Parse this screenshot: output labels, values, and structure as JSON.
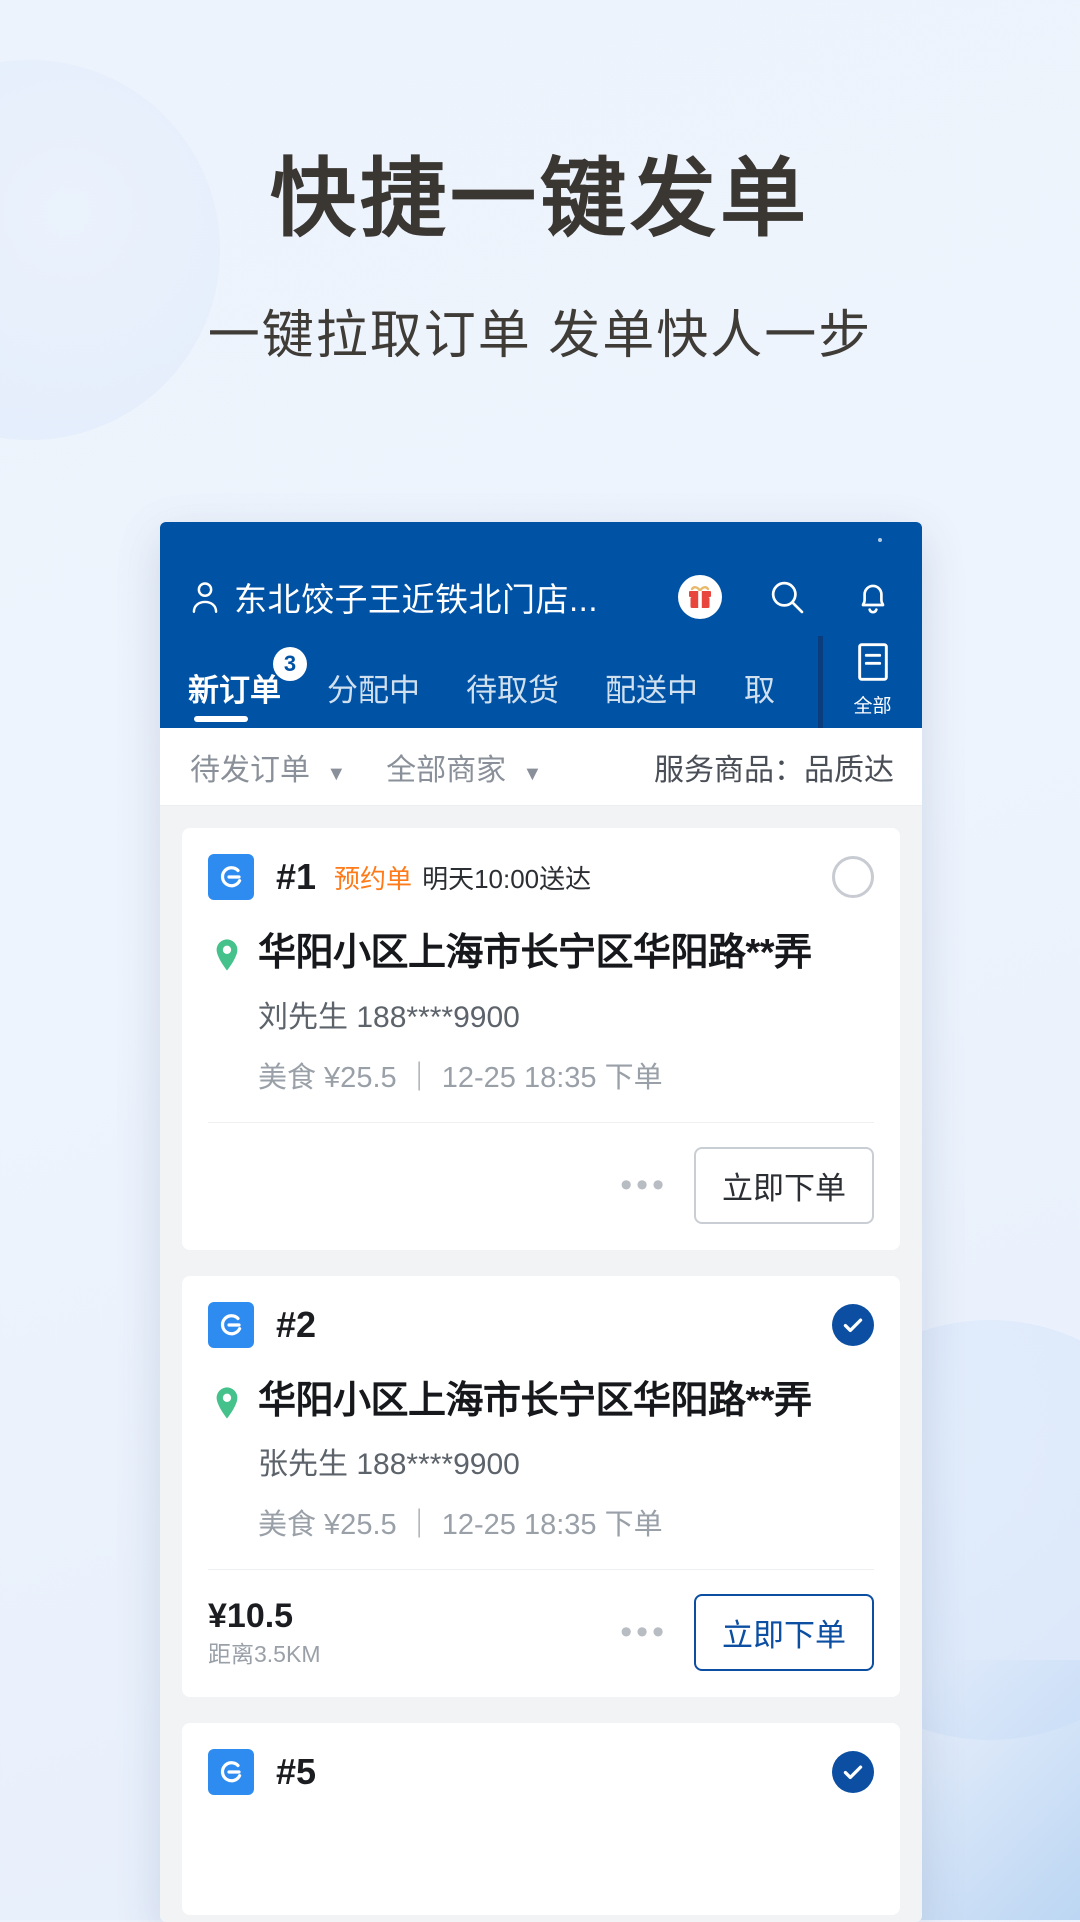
{
  "hero": {
    "title": "快捷一键发单",
    "subtitle": "一键拉取订单 发单快人一步"
  },
  "colors": {
    "nav_blue": "#0052a5",
    "accent_orange": "#ff7a18",
    "eleme_blue": "#2e8cf0",
    "check_blue": "#0b4ea2",
    "pin_green": "#45c18c"
  },
  "nav": {
    "store_name": "东北饺子王近铁北门店...",
    "person_icon": "person-icon",
    "gift_icon": "gift-icon",
    "search_icon": "search-icon",
    "bell_icon": "bell-icon",
    "tabs": [
      {
        "label": "新订单",
        "badge": "3",
        "active": true
      },
      {
        "label": "分配中",
        "badge": "",
        "active": false
      },
      {
        "label": "待取货",
        "badge": "",
        "active": false
      },
      {
        "label": "配送中",
        "badge": "",
        "active": false
      },
      {
        "label": "取",
        "badge": "",
        "active": false
      }
    ],
    "all_tab": {
      "label": "全部",
      "icon": "list-icon"
    }
  },
  "filters": {
    "order_status": "待发订单",
    "merchant": "全部商家",
    "caret": "▼",
    "service": "服务商品：品质达"
  },
  "orders": [
    {
      "platform_icon": "eleme-icon",
      "number": "#1",
      "tag": "预约单",
      "schedule": "明天10:00送达",
      "selected": false,
      "address": "华阳小区上海市长宁区华阳路**弄",
      "contact": "刘先生 188****9900",
      "meta": "美食 ¥25.5 ｜ 12-25 18:35 下单",
      "price": "",
      "distance": "",
      "more": "•••",
      "action": "立即下单"
    },
    {
      "platform_icon": "eleme-icon",
      "number": "#2",
      "tag": "",
      "schedule": "",
      "selected": true,
      "address": "华阳小区上海市长宁区华阳路**弄",
      "contact": "张先生 188****9900",
      "meta": "美食 ¥25.5 ｜ 12-25 18:35 下单",
      "price": "¥10.5",
      "distance": "距离3.5KM",
      "more": "•••",
      "action": "立即下单"
    },
    {
      "platform_icon": "eleme-icon",
      "number": "#5",
      "tag": "",
      "schedule": "",
      "selected": true,
      "address": "",
      "contact": "",
      "meta": "",
      "price": "",
      "distance": "",
      "more": "",
      "action": ""
    }
  ]
}
